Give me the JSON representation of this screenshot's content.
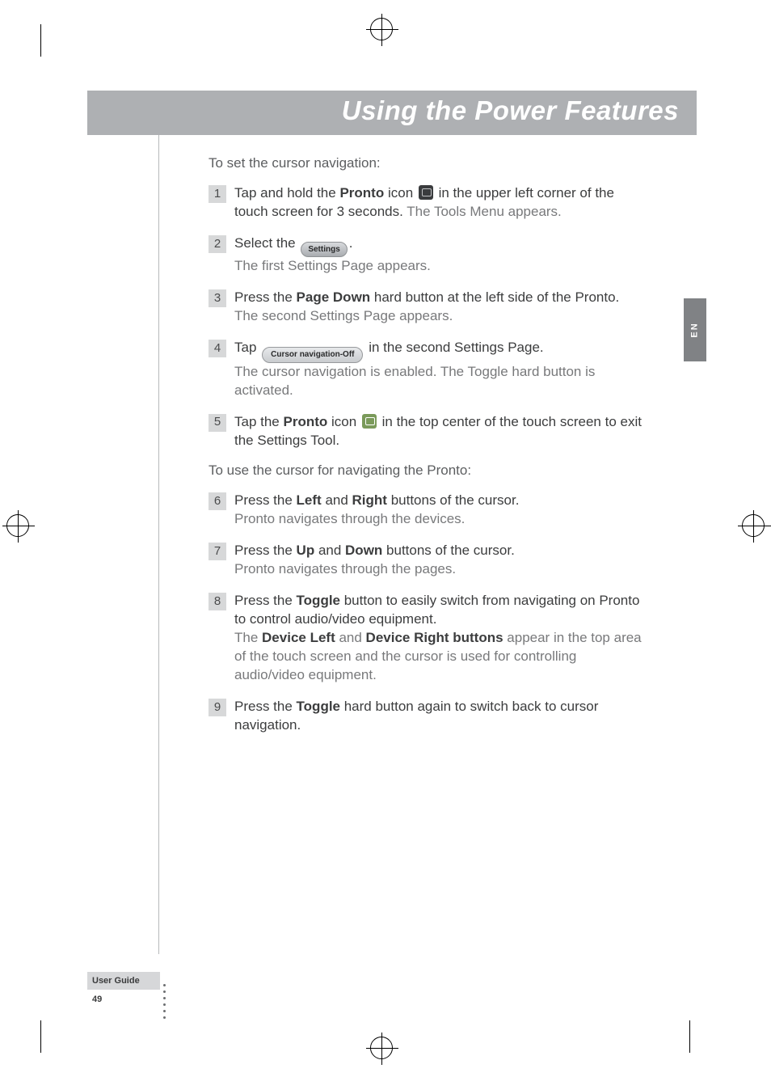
{
  "header": {
    "title": "Using the Power Features"
  },
  "lang_tab": "EN",
  "intro1": "To set the cursor navigation:",
  "intro2": "To use the cursor for navigating the Pronto:",
  "inline": {
    "settings_label": "Settings",
    "cursor_off_label": "Cursor navigation-Off"
  },
  "steps": [
    {
      "n": "1",
      "pre": "Tap and hold the ",
      "bold1": "Pronto",
      "mid": " icon ",
      "icon": "pronto-dark",
      "post": " in the upper left corner of the touch screen for 3 seconds.",
      "light": " The Tools Menu appears."
    },
    {
      "n": "2",
      "pre": "Select the ",
      "icon": "settings-btn",
      "post": ".",
      "light_line": "The first Settings Page appears."
    },
    {
      "n": "3",
      "pre": "Press the ",
      "bold1": "Page Down",
      "post": " hard button at the left side of the Pronto.",
      "light_line": "The second Settings Page appears."
    },
    {
      "n": "4",
      "pre": "Tap ",
      "icon": "cursor-btn",
      "post": " in the second Settings Page.",
      "light_line": "The cursor navigation is enabled. The Toggle hard button is activated."
    },
    {
      "n": "5",
      "pre": "Tap the ",
      "bold1": "Pronto",
      "mid": " icon ",
      "icon": "pronto-green",
      "post": " in the top center of the touch screen to exit the Settings Tool."
    },
    {
      "n": "6",
      "pre": "Press the ",
      "bold1": "Left",
      "mid": " and ",
      "bold2": "Right",
      "post": " buttons of the cursor.",
      "light_line": "Pronto navigates through the devices."
    },
    {
      "n": "7",
      "pre": "Press the ",
      "bold1": "Up",
      "mid": " and ",
      "bold2": "Down",
      "post": " buttons of the cursor.",
      "light_line": "Pronto navigates through the pages."
    },
    {
      "n": "8",
      "pre": "Press the ",
      "bold1": "Toggle",
      "post": " button to easily switch from navigating on Pronto to control audio/video equipment.",
      "light_line_rich": {
        "a": "The ",
        "b": "Device Left",
        "c": " and ",
        "d": "Device Right buttons",
        "e": " appear in the top area of the touch screen and the cursor is used for controlling audio/video equipment."
      }
    },
    {
      "n": "9",
      "pre": "Press the ",
      "bold1": "Toggle",
      "post": " hard button again to switch back to cursor navigation."
    }
  ],
  "footer": {
    "label": "User Guide",
    "page": "49"
  }
}
